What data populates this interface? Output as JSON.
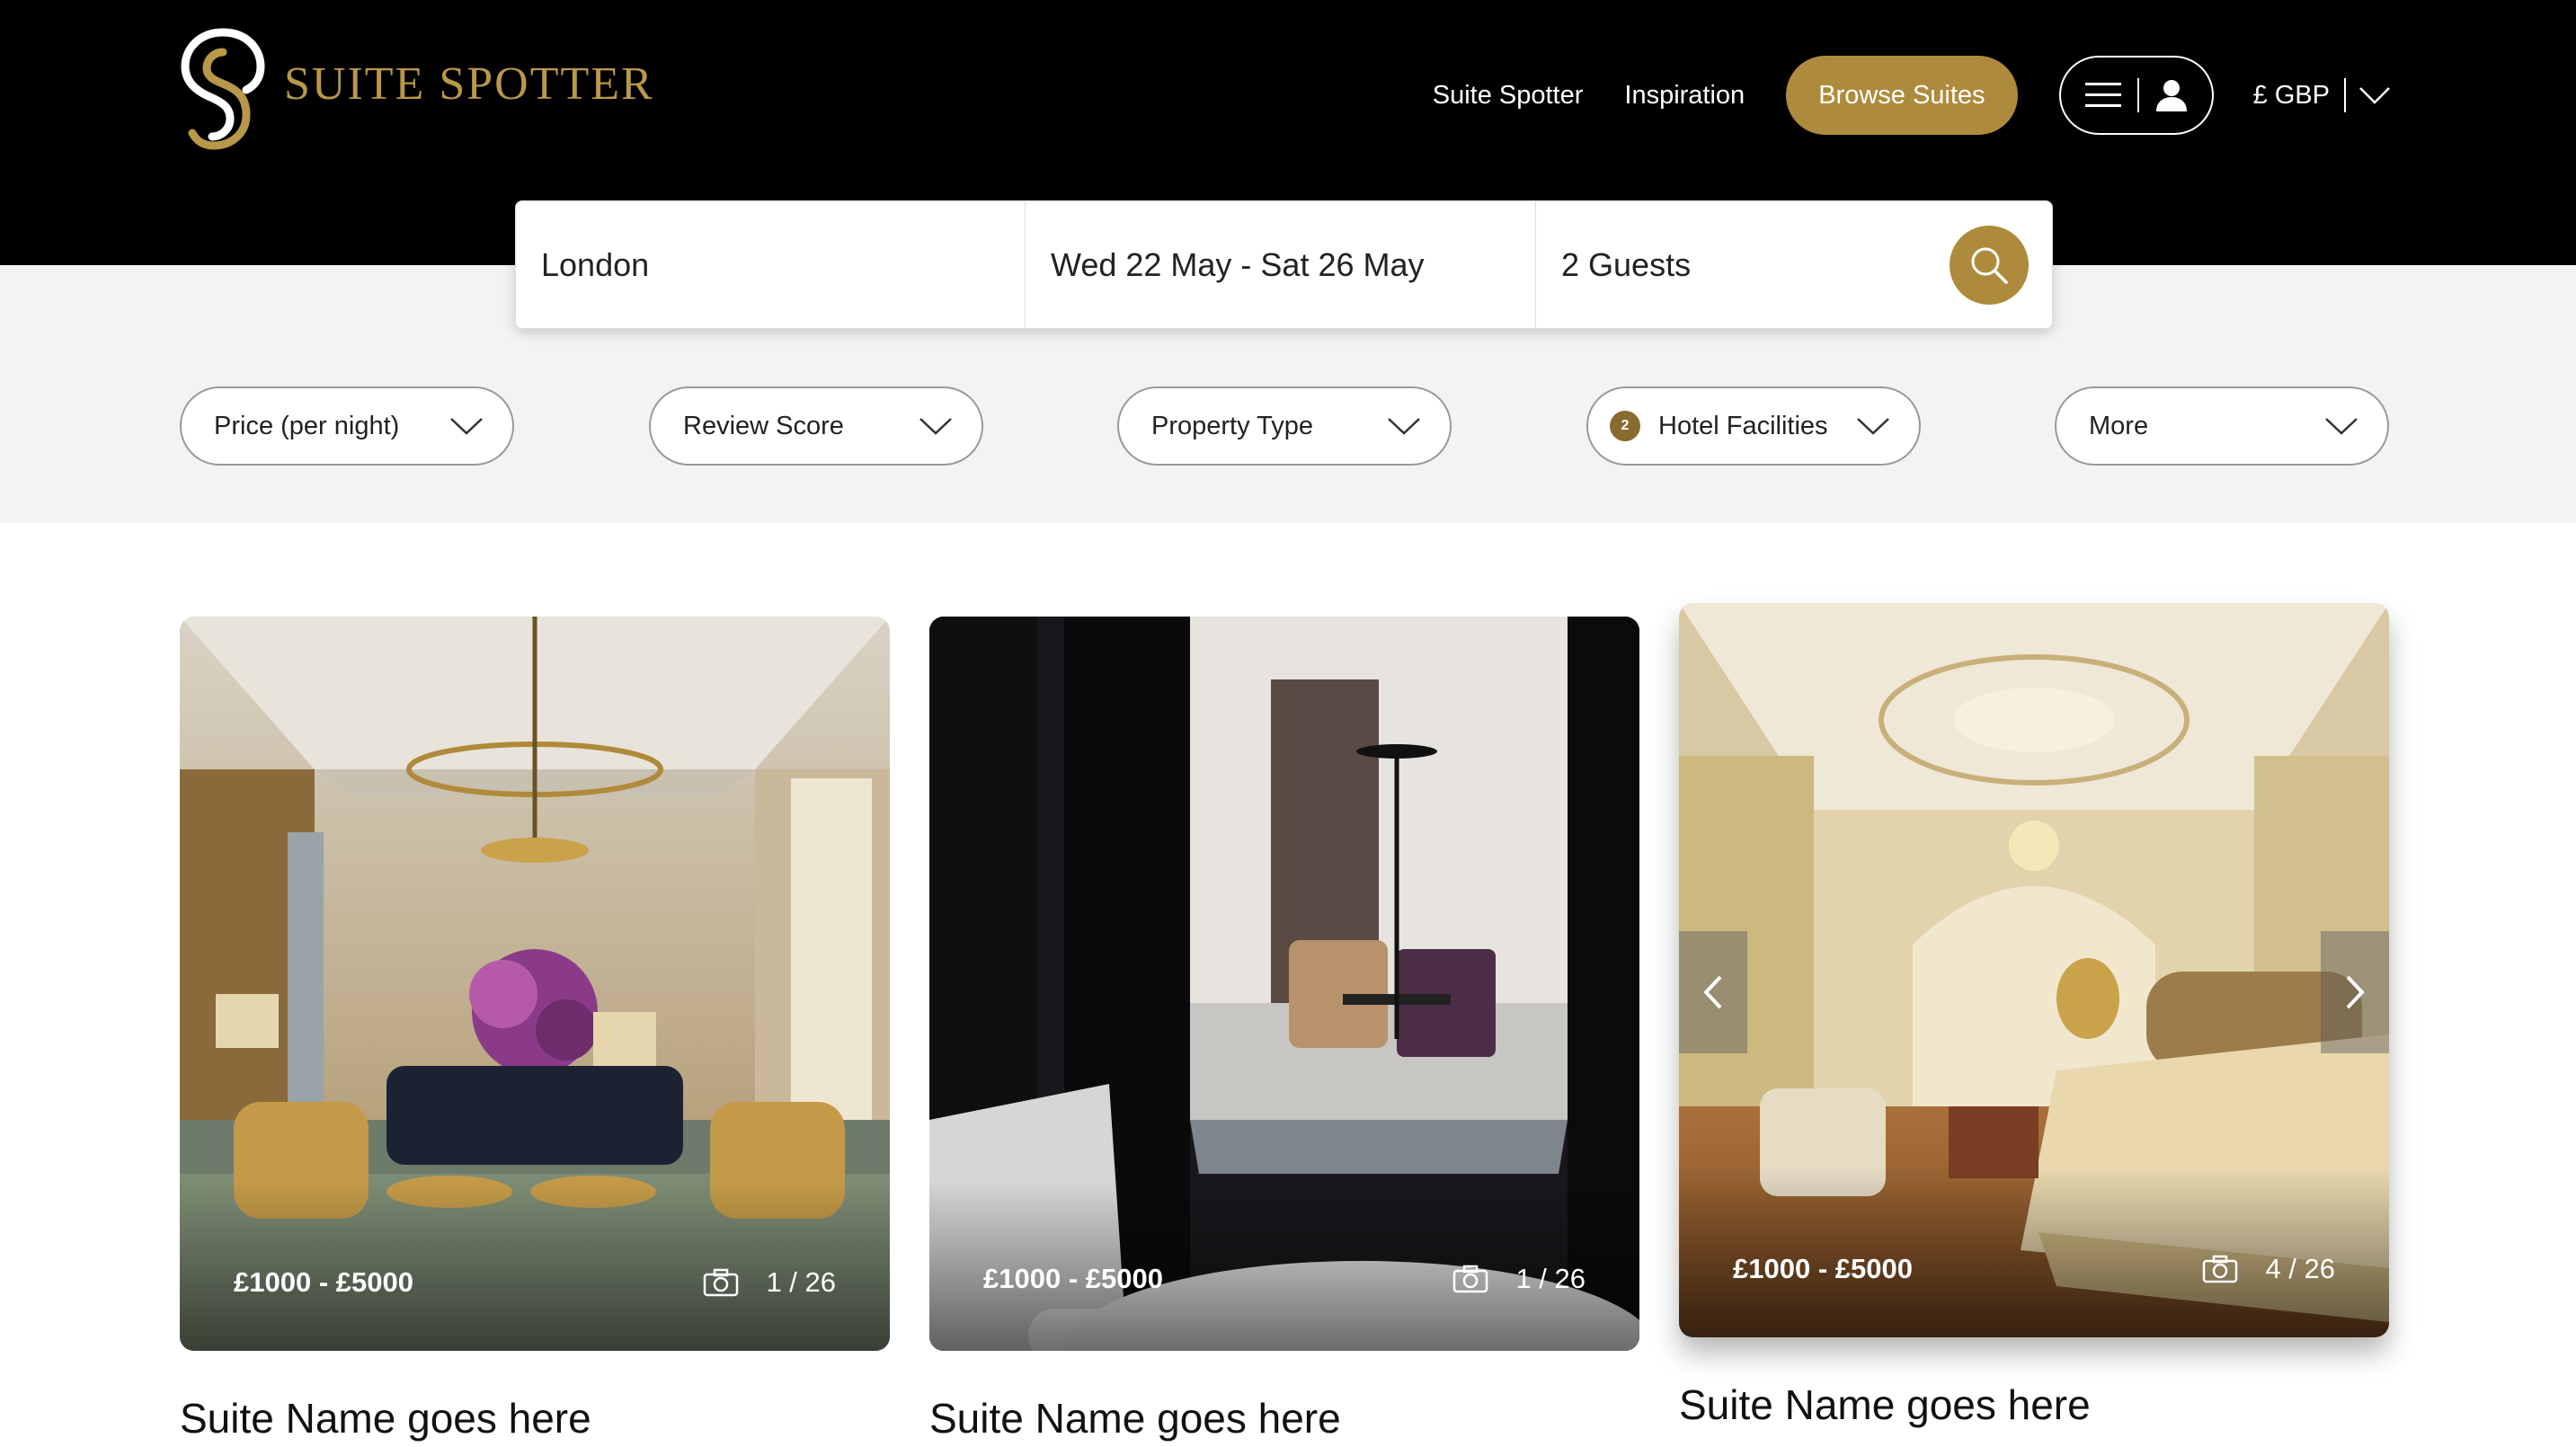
{
  "brand": {
    "name": "SUITE SPOTTER",
    "accent": "#ae8b3c"
  },
  "nav": {
    "links": [
      "Suite Spotter",
      "Inspiration"
    ],
    "browse_label": "Browse Suites",
    "menu_icon": "hamburger-icon",
    "user_icon": "user-icon",
    "currency": "£ GBP"
  },
  "search": {
    "location": "London",
    "dates": "Wed 22 May - Sat 26 May",
    "guests": "2 Guests",
    "icon": "search-icon"
  },
  "filters": [
    {
      "label": "Price (per night)"
    },
    {
      "label": "Review Score"
    },
    {
      "label": "Property Type"
    },
    {
      "label": "Hotel Facilities",
      "badge": "2"
    },
    {
      "label": "More"
    }
  ],
  "cards": [
    {
      "price": "£1000 - £5000",
      "photo_index": "1 / 26",
      "name": "Suite Name goes here"
    },
    {
      "price": "£1000 - £5000",
      "photo_index": "1 / 26",
      "name": "Suite Name goes here"
    },
    {
      "price": "£1000 - £5000",
      "photo_index": "4 / 26",
      "name": "Suite Name goes here"
    }
  ]
}
